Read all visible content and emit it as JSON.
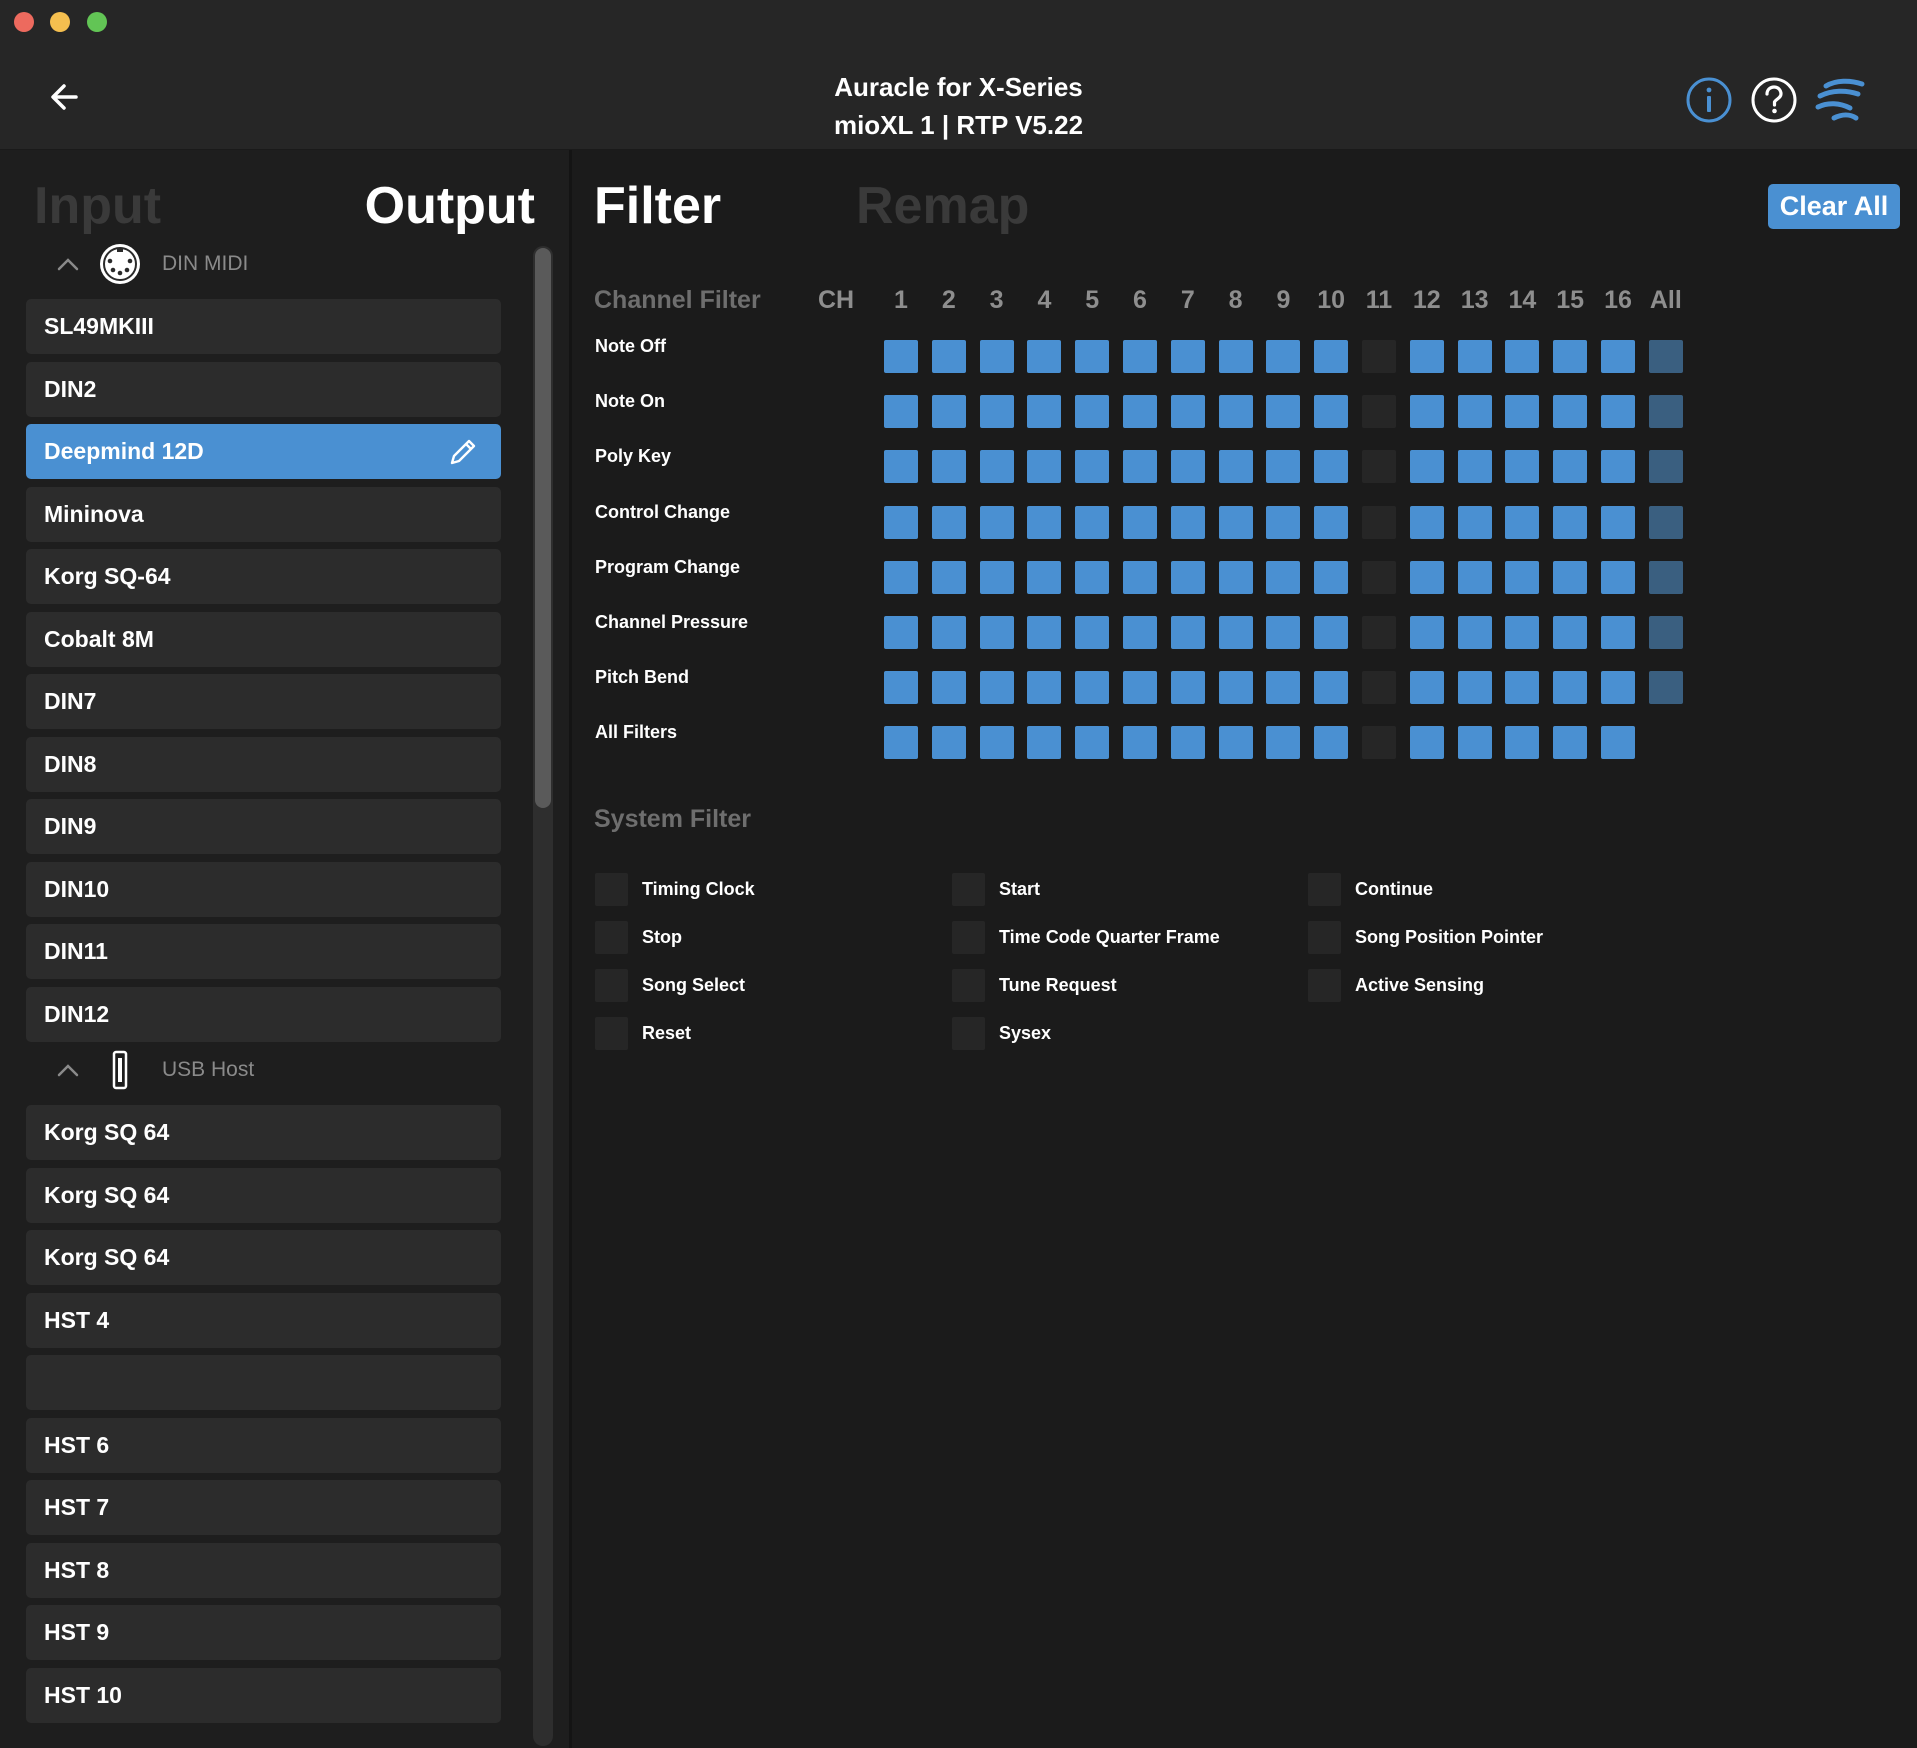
{
  "window": {
    "buttons": [
      "close",
      "minimize",
      "zoom"
    ]
  },
  "header": {
    "title": "Auracle for X-Series",
    "subtitle": "mioXL 1  |  RTP V5.22",
    "icons": [
      "info-icon",
      "help-icon",
      "brand-logo-icon"
    ]
  },
  "left": {
    "tabs": {
      "input": "Input",
      "output": "Output"
    },
    "groups": [
      {
        "label": "DIN MIDI",
        "icon": "din-connector-icon",
        "items": [
          "SL49MKIII",
          "DIN2",
          "Deepmind 12D",
          "Mininova",
          "Korg SQ-64",
          "Cobalt 8M",
          "DIN7",
          "DIN8",
          "DIN9",
          "DIN10",
          "DIN11",
          "DIN12"
        ],
        "selected_index": 2
      },
      {
        "label": "USB Host",
        "icon": "usb-icon",
        "items": [
          "Korg SQ 64",
          "Korg SQ 64",
          "Korg SQ 64",
          "HST 4",
          "",
          "HST 6",
          "HST 7",
          "HST 8",
          "HST 9",
          "HST 10"
        ]
      }
    ]
  },
  "right": {
    "tabs": {
      "filter": "Filter",
      "remap": "Remap"
    },
    "clear_all": "Clear All",
    "channel_filter": {
      "title": "Channel Filter",
      "ch_label": "CH",
      "channels": [
        "1",
        "2",
        "3",
        "4",
        "5",
        "6",
        "7",
        "8",
        "9",
        "10",
        "11",
        "12",
        "13",
        "14",
        "15",
        "16"
      ],
      "all_label": "All",
      "rows": [
        {
          "label": "Note Off",
          "channels_on": [
            1,
            1,
            1,
            1,
            1,
            1,
            1,
            1,
            1,
            1,
            0,
            1,
            1,
            1,
            1,
            1
          ],
          "all": "partial"
        },
        {
          "label": "Note On",
          "channels_on": [
            1,
            1,
            1,
            1,
            1,
            1,
            1,
            1,
            1,
            1,
            0,
            1,
            1,
            1,
            1,
            1
          ],
          "all": "partial"
        },
        {
          "label": "Poly Key",
          "channels_on": [
            1,
            1,
            1,
            1,
            1,
            1,
            1,
            1,
            1,
            1,
            0,
            1,
            1,
            1,
            1,
            1
          ],
          "all": "partial"
        },
        {
          "label": "Control Change",
          "channels_on": [
            1,
            1,
            1,
            1,
            1,
            1,
            1,
            1,
            1,
            1,
            0,
            1,
            1,
            1,
            1,
            1
          ],
          "all": "partial"
        },
        {
          "label": "Program Change",
          "channels_on": [
            1,
            1,
            1,
            1,
            1,
            1,
            1,
            1,
            1,
            1,
            0,
            1,
            1,
            1,
            1,
            1
          ],
          "all": "partial"
        },
        {
          "label": "Channel Pressure",
          "channels_on": [
            1,
            1,
            1,
            1,
            1,
            1,
            1,
            1,
            1,
            1,
            0,
            1,
            1,
            1,
            1,
            1
          ],
          "all": "partial"
        },
        {
          "label": "Pitch Bend",
          "channels_on": [
            1,
            1,
            1,
            1,
            1,
            1,
            1,
            1,
            1,
            1,
            0,
            1,
            1,
            1,
            1,
            1
          ],
          "all": "partial"
        },
        {
          "label": "All Filters",
          "channels_on": [
            1,
            1,
            1,
            1,
            1,
            1,
            1,
            1,
            1,
            1,
            0,
            1,
            1,
            1,
            1,
            1
          ],
          "all": "none"
        }
      ]
    },
    "system_filter": {
      "title": "System Filter",
      "columns": [
        [
          "Timing Clock",
          "Stop",
          "Song Select",
          "Reset"
        ],
        [
          "Start",
          "Time Code Quarter Frame",
          "Tune Request",
          "Sysex"
        ],
        [
          "Continue",
          "Song Position Pointer",
          "Active Sensing"
        ]
      ]
    }
  },
  "colors": {
    "accent": "#4a90d2",
    "all_partial": "#3a5f80",
    "off": "#262626",
    "bg": "#1b1b1b"
  }
}
